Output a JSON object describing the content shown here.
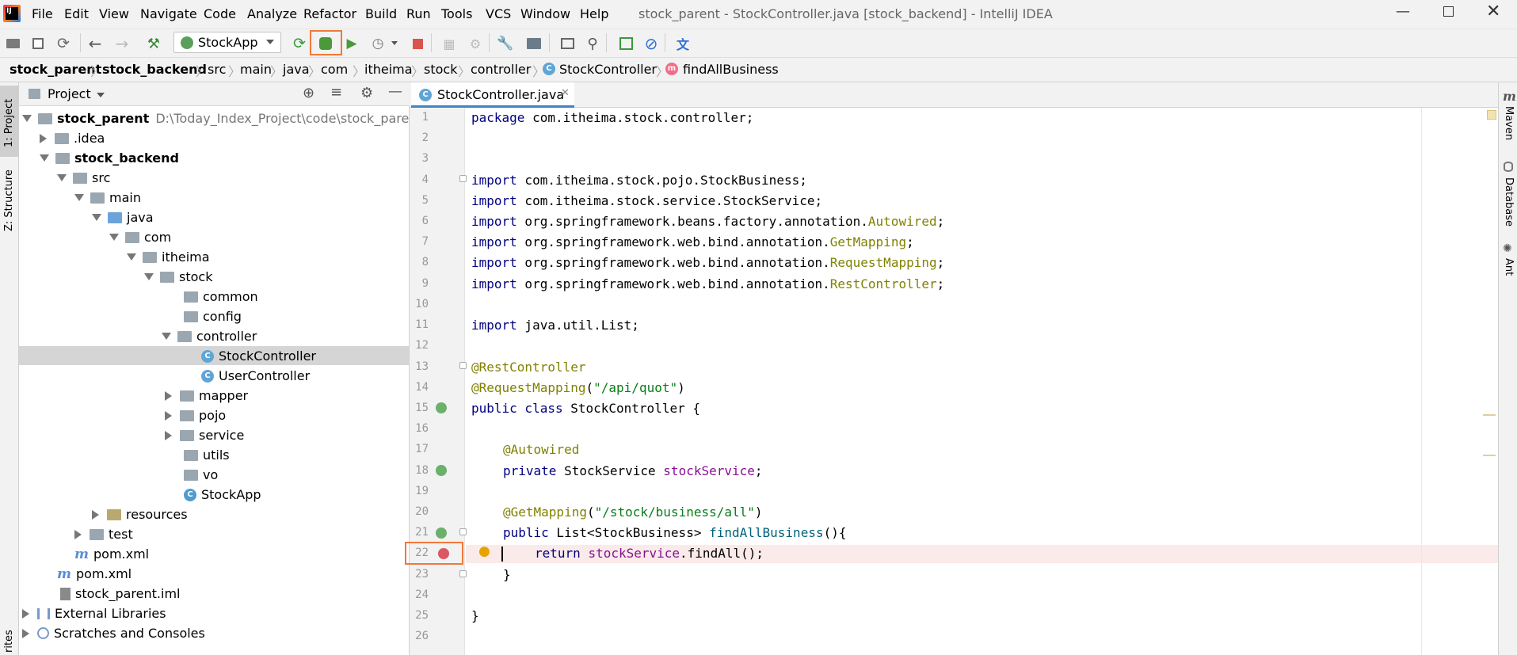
{
  "window": {
    "title": "stock_parent - StockController.java [stock_backend] - IntelliJ IDEA",
    "app_icon_text": "IJ"
  },
  "menu": [
    "File",
    "Edit",
    "View",
    "Navigate",
    "Code",
    "Analyze",
    "Refactor",
    "Build",
    "Run",
    "Tools",
    "VCS",
    "Window",
    "Help"
  ],
  "toolbar": {
    "run_config": "StockApp"
  },
  "breadcrumb": [
    "stock_parent",
    "stock_backend",
    "src",
    "main",
    "java",
    "com",
    "itheima",
    "stock",
    "controller",
    "StockController",
    "findAllBusiness"
  ],
  "left_strip": {
    "project_label": "1: Project",
    "structure_label": "Z: Structure",
    "favorites_label": "rites"
  },
  "right_strip": {
    "maven_label": "Maven",
    "database_label": "Database",
    "ant_label": "Ant"
  },
  "project_panel": {
    "title": "Project",
    "tree": [
      {
        "label": "stock_parent",
        "path": "D:\\Today_Index_Project\\code\\stock_parent"
      },
      {
        "label": ".idea"
      },
      {
        "label": "stock_backend"
      },
      {
        "label": "src"
      },
      {
        "label": "main"
      },
      {
        "label": "java"
      },
      {
        "label": "com"
      },
      {
        "label": "itheima"
      },
      {
        "label": "stock"
      },
      {
        "label": "common"
      },
      {
        "label": "config"
      },
      {
        "label": "controller"
      },
      {
        "label": "StockController"
      },
      {
        "label": "UserController"
      },
      {
        "label": "mapper"
      },
      {
        "label": "pojo"
      },
      {
        "label": "service"
      },
      {
        "label": "utils"
      },
      {
        "label": "vo"
      },
      {
        "label": "StockApp"
      },
      {
        "label": "resources"
      },
      {
        "label": "test"
      },
      {
        "label": "pom.xml"
      },
      {
        "label": "pom.xml"
      },
      {
        "label": "stock_parent.iml"
      },
      {
        "label": "External Libraries"
      },
      {
        "label": "Scratches and Consoles"
      }
    ]
  },
  "editor": {
    "tab_label": "StockController.java",
    "line_numbers": [
      "1",
      "2",
      "3",
      "4",
      "5",
      "6",
      "7",
      "8",
      "9",
      "10",
      "11",
      "12",
      "13",
      "14",
      "15",
      "16",
      "17",
      "18",
      "19",
      "20",
      "21",
      "22",
      "23",
      "24",
      "25",
      "26"
    ],
    "code": {
      "l1_kw": "package",
      "l1_rest": " com.itheima.stock.controller;",
      "l4_kw": "import",
      "l4_rest": " com.itheima.stock.pojo.StockBusiness;",
      "l5_kw": "import",
      "l5_rest": " com.itheima.stock.service.StockService;",
      "l6_kw": "import",
      "l6_pre": " org.springframework.beans.factory.annotation.",
      "l6_ann": "Autowired",
      "l6_post": ";",
      "l7_kw": "import",
      "l7_pre": " org.springframework.web.bind.annotation.",
      "l7_ann": "GetMapping",
      "l7_post": ";",
      "l8_kw": "import",
      "l8_pre": " org.springframework.web.bind.annotation.",
      "l8_ann": "RequestMapping",
      "l8_post": ";",
      "l9_kw": "import",
      "l9_pre": " org.springframework.web.bind.annotation.",
      "l9_ann": "RestController",
      "l9_post": ";",
      "l11_kw": "import",
      "l11_rest": " java.util.List;",
      "l13_ann": "@RestController",
      "l14_ann": "@RequestMapping",
      "l14_open": "(",
      "l14_str": "\"/api/quot\"",
      "l14_close": ")",
      "l15_kw": "public class",
      "l15_rest": " StockController {",
      "l17_ann": "@Autowired",
      "l18_kw": "private",
      "l18_type": " StockService ",
      "l18_fld": "stockService",
      "l18_post": ";",
      "l20_ann": "@GetMapping",
      "l20_open": "(",
      "l20_str": "\"/stock/business/all\"",
      "l20_close": ")",
      "l21_kw": "public",
      "l21_type": " List<StockBusiness> ",
      "l21_mth": "findAllBusiness",
      "l21_post": "(){",
      "l22_kw": "return",
      "l22_sp": " ",
      "l22_fld": "stockService",
      "l22_post": ".findAll();",
      "l23": "}",
      "l25": "}"
    }
  },
  "colors": {
    "breakpoint": "#db5860",
    "highlight_box": "#f0783c",
    "breakpoint_line_bg": "#faeae9",
    "selected_row_bg": "#d5d5d5"
  }
}
